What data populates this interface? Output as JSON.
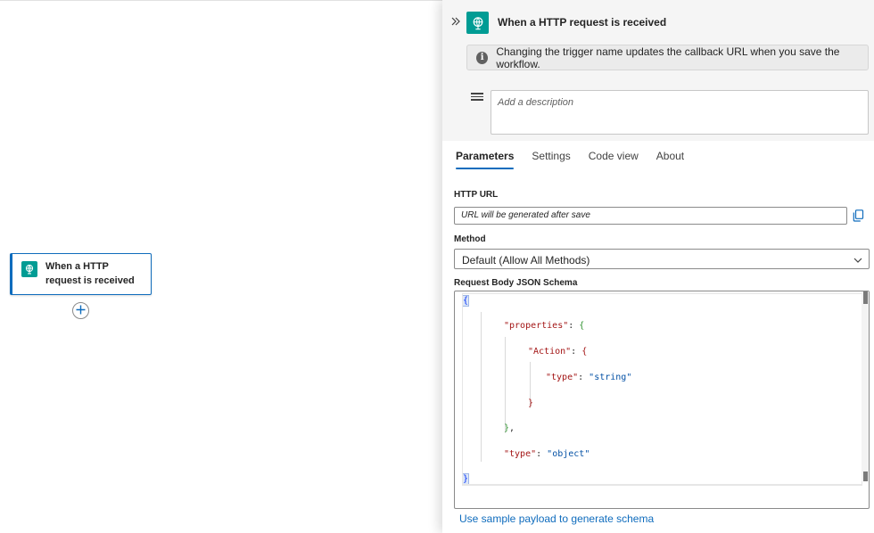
{
  "canvas": {
    "node": {
      "label": "When a HTTP request is received",
      "icon": "request-globe-icon"
    },
    "add_button_icon": "plus-icon"
  },
  "panel": {
    "title": "When a HTTP request is received",
    "collapse_icon": "double-chevron-right-icon",
    "info_message": "Changing the trigger name updates the callback URL when you save the workflow.",
    "description_placeholder": "Add a description",
    "tabs": [
      {
        "label": "Parameters",
        "active": true
      },
      {
        "label": "Settings",
        "active": false
      },
      {
        "label": "Code view",
        "active": false
      },
      {
        "label": "About",
        "active": false
      }
    ],
    "http_url": {
      "label": "HTTP URL",
      "value": "URL will be generated after save"
    },
    "method": {
      "label": "Method",
      "value": "Default (Allow All Methods)"
    },
    "schema": {
      "label": "Request Body JSON Schema",
      "lines": [
        {
          "tokens": [
            {
              "t": "{",
              "c": "brace-blue"
            }
          ]
        },
        {
          "tokens": [
            {
              "t": "\"properties\"",
              "c": "key"
            },
            {
              "t": ": ",
              "c": "punct"
            },
            {
              "t": "{",
              "c": "brace"
            }
          ]
        },
        {
          "tokens": [
            {
              "t": "\"Action\"",
              "c": "key"
            },
            {
              "t": ": ",
              "c": "punct"
            },
            {
              "t": "{",
              "c": "key"
            }
          ]
        },
        {
          "tokens": [
            {
              "t": "\"type\"",
              "c": "key"
            },
            {
              "t": ": ",
              "c": "punct"
            },
            {
              "t": "\"string\"",
              "c": "str"
            }
          ]
        },
        {
          "tokens": [
            {
              "t": "}",
              "c": "key"
            }
          ]
        },
        {
          "tokens": [
            {
              "t": "}",
              "c": "brace"
            },
            {
              "t": ",",
              "c": "punct"
            }
          ]
        },
        {
          "tokens": [
            {
              "t": "\"type\"",
              "c": "key"
            },
            {
              "t": ": ",
              "c": "punct"
            },
            {
              "t": "\"object\"",
              "c": "str"
            }
          ]
        },
        {
          "tokens": [
            {
              "t": "}",
              "c": "brace-blue"
            }
          ]
        }
      ]
    },
    "sample_link": "Use sample payload to generate schema"
  },
  "colors": {
    "accent": "#0f6cbd",
    "trigger_icon": "#009c94"
  }
}
